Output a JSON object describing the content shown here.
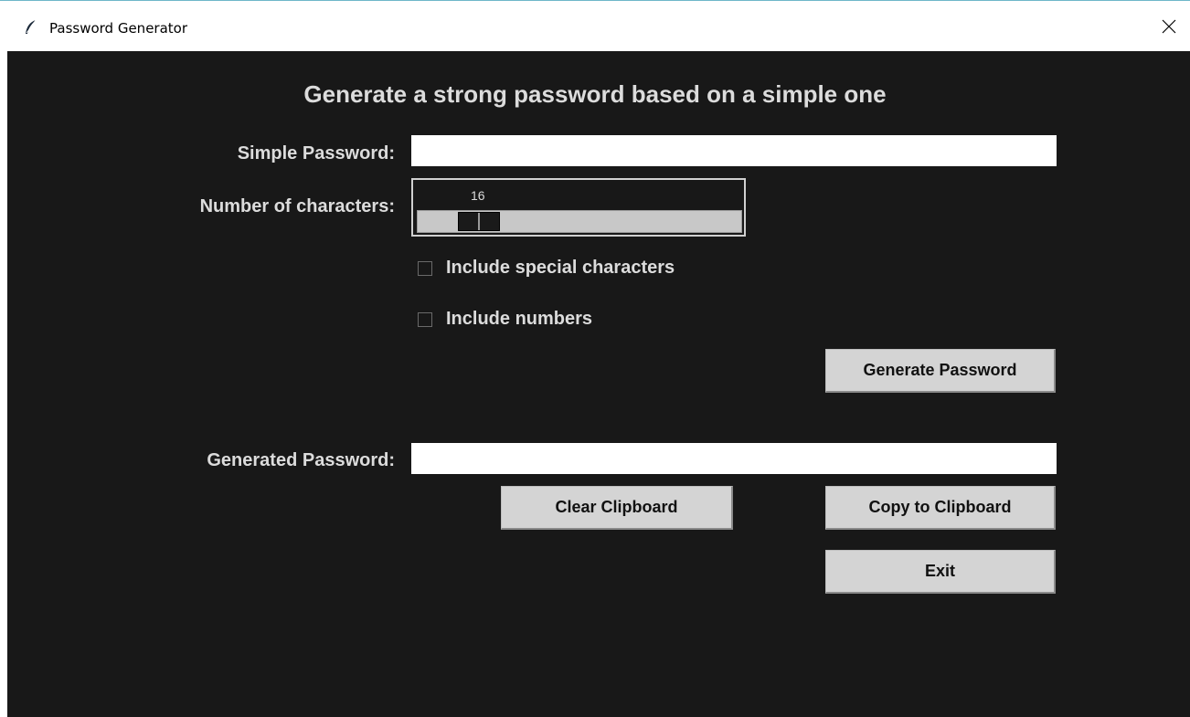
{
  "window": {
    "title": "Password Generator",
    "icon": "feather-icon",
    "close_icon": "close-icon"
  },
  "heading": "Generate a strong password based on a simple one",
  "simple_password": {
    "label": "Simple Password:",
    "value": ""
  },
  "length": {
    "label": "Number of characters:",
    "value": "16"
  },
  "options": {
    "special_label": "Include special characters",
    "special_checked": false,
    "numbers_label": "Include numbers",
    "numbers_checked": false
  },
  "buttons": {
    "generate": "Generate Password",
    "clear": "Clear Clipboard",
    "copy": "Copy to Clipboard",
    "exit": "Exit"
  },
  "generated_password": {
    "label": "Generated Password:",
    "value": ""
  },
  "colors": {
    "background": "#181818",
    "text": "#dcdcdc",
    "button": "#d4d4d4"
  }
}
